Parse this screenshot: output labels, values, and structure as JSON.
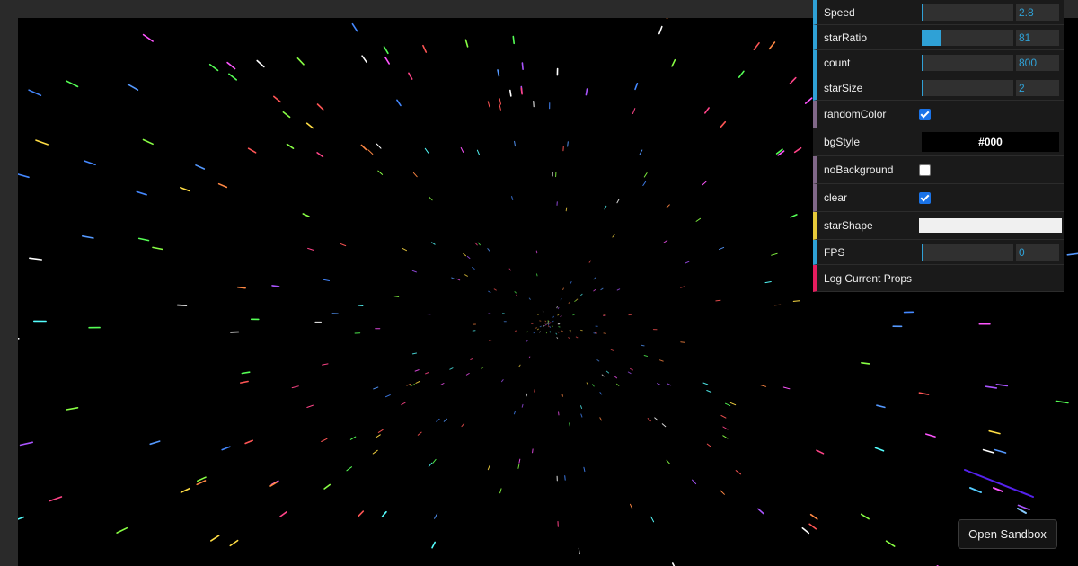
{
  "gui": {
    "speed": {
      "label": "Speed",
      "value": "2.8",
      "fill": 0.01
    },
    "starRatio": {
      "label": "starRatio",
      "value": "81",
      "fill": 0.22
    },
    "count": {
      "label": "count",
      "value": "800",
      "fill": 0.01
    },
    "starSize": {
      "label": "starSize",
      "value": "2",
      "fill": 0.01
    },
    "randomColor": {
      "label": "randomColor",
      "checked": true
    },
    "bgStyle": {
      "label": "bgStyle",
      "value": "#000"
    },
    "noBackground": {
      "label": "noBackground",
      "checked": false
    },
    "clear": {
      "label": "clear",
      "checked": true
    },
    "starShape": {
      "label": "starShape",
      "value": ""
    },
    "fps": {
      "label": "FPS",
      "value": "0",
      "fill": 0.0
    },
    "logProps": {
      "label": "Log Current Props"
    }
  },
  "sandbox": {
    "label": "Open Sandbox"
  },
  "colors": {
    "background": "#000000",
    "slider_accent": "#2fa1d6",
    "bool_accent": "#806787",
    "shape_accent": "#e6c93a",
    "function_accent": "#e61d5f",
    "checkbox_on": "#1a73e8"
  }
}
